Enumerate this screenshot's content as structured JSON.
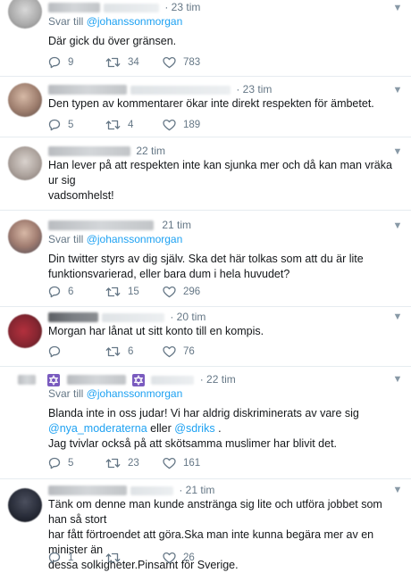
{
  "timeline": {
    "tweets": [
      {
        "time": "· 23 tim",
        "reply_prefix": "Svar till",
        "reply_handle": "@johanssonmorgan",
        "text_lines": [
          "Där gick du över gränsen."
        ],
        "replies": "9",
        "retweets": "34",
        "likes": "783"
      },
      {
        "time": "· 23 tim",
        "text_lines": [
          "Den typen av kommentarer ökar inte direkt respekten för ämbetet."
        ],
        "replies": "5",
        "retweets": "4",
        "likes": "189"
      },
      {
        "time": "22 tim",
        "text_lines": [
          "Han lever på att respekten inte kan sjunka mer och då kan man vräka ur sig",
          "vadsomhelst!"
        ],
        "replies": "",
        "retweets": "",
        "likes": ""
      },
      {
        "time": "21 tim",
        "reply_prefix": "Svar till",
        "reply_handle": "@johanssonmorgan",
        "text_lines": [
          "Din twitter styrs av dig själv. Ska det här tolkas som att du är lite",
          "funktionsvarierad, eller bara dum i hela huvudet?"
        ],
        "replies": "6",
        "retweets": "15",
        "likes": "296"
      },
      {
        "time": "· 20 tim",
        "text_lines": [
          "Morgan har lånat ut sitt konto till en kompis."
        ],
        "replies": "",
        "retweets": "6",
        "likes": "76"
      },
      {
        "time": "· 22 tim",
        "reply_prefix": "Svar till",
        "reply_handle": "@johanssonmorgan",
        "text_line1": "Blanda inte in oss judar! Vi har aldrig diskriminerats av vare sig",
        "mention_a": "@nya_moderaterna",
        "mention_join": " eller ",
        "mention_b": "@sdriks",
        "mention_end": " .",
        "text_line3": "Jag tvivlar också på att skötsamma muslimer har blivit det.",
        "replies": "5",
        "retweets": "23",
        "likes": "161"
      },
      {
        "time": "· 21 tim",
        "text_lines": [
          "Tänk om denne man kunde anstränga sig lite och utföra jobbet som han så stort",
          "har fått förtroendet att göra.Ska man inte kunna begära mer av en minister än",
          "dessa solkigheter.Pinsamt för Sverige."
        ],
        "replies": "1",
        "retweets": "",
        "likes": "26"
      }
    ]
  },
  "icons": {
    "reply": "reply-icon",
    "retweet": "retweet-icon",
    "like": "heart-icon",
    "caret": "chevron-down-icon",
    "star_of_david": "star-of-david-icon"
  },
  "colors": {
    "link": "#1da1f2",
    "meta": "#657786",
    "text": "#14171a",
    "divider": "#e6ecf0",
    "star_badge": "#7a5bbf"
  }
}
